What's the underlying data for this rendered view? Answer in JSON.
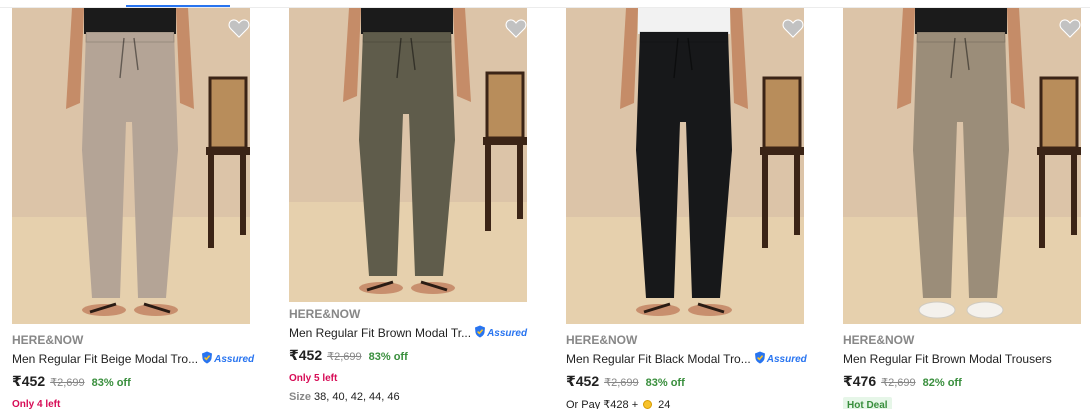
{
  "products": [
    {
      "brand": "HERE&NOW",
      "title": "Men Regular Fit Beige Modal Tro...",
      "assured": "Assured",
      "price": "₹452",
      "mrp": "₹2,699",
      "discount": "83% off",
      "stock": "Only 4 left",
      "colors": {
        "bg": "#dcc4a8",
        "floor": "#e6d0ad",
        "pant": "#b4a496",
        "shirt": "#1b1b1b"
      },
      "footwear": "sandal"
    },
    {
      "brand": "HERE&NOW",
      "title": "Men Regular Fit Brown Modal Tr...",
      "assured": "Assured",
      "price": "₹452",
      "mrp": "₹2,699",
      "discount": "83% off",
      "stock": "Only 5 left",
      "size_label": "Size",
      "sizes": "38, 40, 42, 44, 46",
      "colors": {
        "bg": "#dcc4a8",
        "floor": "#e6d0ad",
        "pant": "#5f5c4b",
        "shirt": "#1b1b1b"
      },
      "footwear": "sandal"
    },
    {
      "brand": "HERE&NOW",
      "title": "Men Regular Fit Black Modal Tro...",
      "assured": "Assured",
      "price": "₹452",
      "mrp": "₹2,699",
      "discount": "83% off",
      "pay_text": "Or Pay ₹428 +",
      "pay_coins": "24",
      "colors": {
        "bg": "#dcc4a8",
        "floor": "#e6d0ad",
        "pant": "#17181a",
        "shirt": "#f2f2f2"
      },
      "footwear": "sandal"
    },
    {
      "brand": "HERE&NOW",
      "title": "Men Regular Fit Brown Modal Trousers",
      "price": "₹476",
      "mrp": "₹2,699",
      "discount": "82% off",
      "badge": "Hot Deal",
      "colors": {
        "bg": "#dcc4a8",
        "floor": "#e6d0ad",
        "pant": "#9b8d79",
        "shirt": "#1b1b1b"
      },
      "footwear": "sneaker"
    }
  ]
}
